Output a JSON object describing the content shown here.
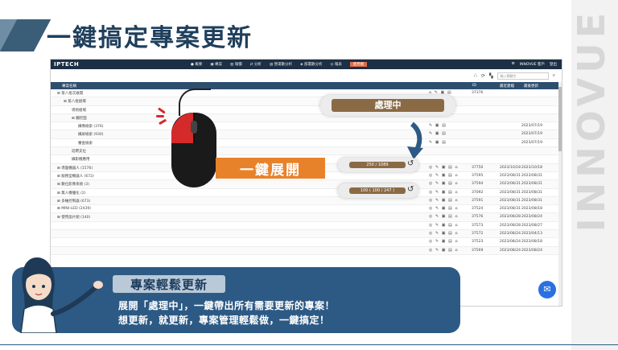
{
  "page": {
    "title": "一鍵搞定專案更新"
  },
  "brand": {
    "vertical_text": "INNOVUE"
  },
  "app": {
    "logo": "IPTECH",
    "nav": [
      {
        "label": "● 概要"
      },
      {
        "label": "▣ 專案"
      },
      {
        "label": "▥ 報價"
      },
      {
        "label": "⇄ 分析"
      },
      {
        "label": "▤ 營運數分析"
      },
      {
        "label": "◈ 部署數分析"
      },
      {
        "label": "◎ 報表"
      },
      {
        "label": "使用者"
      }
    ],
    "nav_right": [
      "⚙",
      "INNOVUE 客戶",
      "登出"
    ],
    "search_placeholder": "輸入關鍵字",
    "table_headers": {
      "name": "專案名稱",
      "id": "ID",
      "d1": "最近建檔",
      "d2": "最後更新"
    },
    "rows": [
      {
        "name": "⊞ 第八批次展開",
        "indent": 8,
        "ops": "⌂ ✎ ▣ ▤",
        "id": "37376",
        "d1": "",
        "d2": ""
      },
      {
        "name": "⊞ 第八批組場",
        "indent": 16,
        "ops": "",
        "id": "",
        "d1": "",
        "d2": ""
      },
      {
        "name": "導熱組場",
        "indent": 26,
        "ops": "",
        "id": "",
        "d1": "",
        "d2": ""
      },
      {
        "name": "⊞ 觸控面",
        "indent": 26,
        "ops": "",
        "id": "",
        "d1": "",
        "d2": ""
      },
      {
        "name": "攝像檢索 (376)",
        "indent": 34,
        "ops": "✎ ▣ ▤",
        "id": "",
        "d1": "",
        "d2": "2023/07/19"
      },
      {
        "name": "攝屏檢索 (930)",
        "indent": 34,
        "ops": "✎ ▣ ▤",
        "id": "",
        "d1": "",
        "d2": "2023/07/19"
      },
      {
        "name": "審查檢索",
        "indent": 34,
        "ops": "✎ ▣ ▤",
        "id": "",
        "d1": "",
        "d2": "2023/07/19"
      },
      {
        "name": "延聘支位",
        "indent": 26,
        "ops": "",
        "id": "",
        "d1": "",
        "d2": ""
      },
      {
        "name": "攝影機應用",
        "indent": 26,
        "ops": "",
        "id": "",
        "d1": "",
        "d2": ""
      },
      {
        "name": "⊞ 導盤機器人 (1576)",
        "indent": 8,
        "ops": "◎ ✎ ▣ ▤ ⌂",
        "id": "37750",
        "d1": "2023/10/18",
        "d2": "2023/10/18"
      },
      {
        "name": "⊞ 服務型機器人 (672)",
        "indent": 8,
        "ops": "◎ ✎ ▣ ▤ ⌂",
        "id": "37595",
        "d1": "2023/08/31",
        "d2": "2023/08/31"
      },
      {
        "name": "⊞ 數位影像系統 (3)",
        "indent": 8,
        "ops": "◎ ✎ ▣ ▤ ⌂",
        "id": "37594",
        "d1": "2023/08/31",
        "d2": "2023/08/31"
      },
      {
        "name": "⊞ 無人機優化 (2)",
        "indent": 8,
        "ops": "◎ ✎ ▣ ▤ ⌂",
        "id": "37092",
        "d1": "2023/08/31",
        "d2": "2023/08/31"
      },
      {
        "name": "⊞ 多軸控制器 (673)",
        "indent": 8,
        "ops": "◎ ✎ ▣ ▤ ⌂",
        "id": "37591",
        "d1": "2023/08/31",
        "d2": "2023/08/31"
      },
      {
        "name": "⊞ MINI-LED (2439)",
        "indent": 8,
        "ops": "◎ ✎ ▣ ▤ ⌂",
        "id": "37524",
        "d1": "2023/08/31",
        "d2": "2023/08/18"
      },
      {
        "name": "⊞ 使用晶片組 (140)",
        "indent": 8,
        "ops": "◎ ✎ ▣ ▤ ⌂",
        "id": "37576",
        "d1": "2023/08/28",
        "d2": "2023/08/24"
      },
      {
        "name": "",
        "indent": 8,
        "ops": "◎ ✎ ▣ ▤ ⌂",
        "id": "37573",
        "d1": "2023/08/28",
        "d2": "2023/08/27"
      },
      {
        "name": "",
        "indent": 8,
        "ops": "◎ ✎ ▣ ▤ ⌂",
        "id": "37572",
        "d1": "2023/08/24",
        "d2": "2023/04/13"
      },
      {
        "name": "",
        "indent": 8,
        "ops": "◎ ✎ ▣ ▤ ⌂",
        "id": "37523",
        "d1": "2023/08/24",
        "d2": "2023/08/18"
      },
      {
        "name": "",
        "indent": 8,
        "ops": "◎ ✎ ▣ ▤ ⌂",
        "id": "37569",
        "d1": "2023/08/24",
        "d2": "2023/08/24"
      }
    ]
  },
  "overlays": {
    "processing_label": "處理中",
    "progress1_label": "250 / 1089",
    "progress1_fraction": 0.23,
    "progress2_label": "100 ( 100 / 247 )",
    "progress2_fraction": 0.4,
    "one_key_label": "一鍵展開"
  },
  "bubble": {
    "title": "專案輕鬆更新",
    "line1": "展開「處理中」，一鍵帶出所有需要更新的專案！",
    "line2": "想更新，就更新，專案管理輕鬆做，一鍵搞定！"
  },
  "colors": {
    "navy": "#1c2f44",
    "accent_orange": "#e8822a",
    "bubble_blue": "#2d5a84",
    "mouse_red": "#d42a2a"
  }
}
